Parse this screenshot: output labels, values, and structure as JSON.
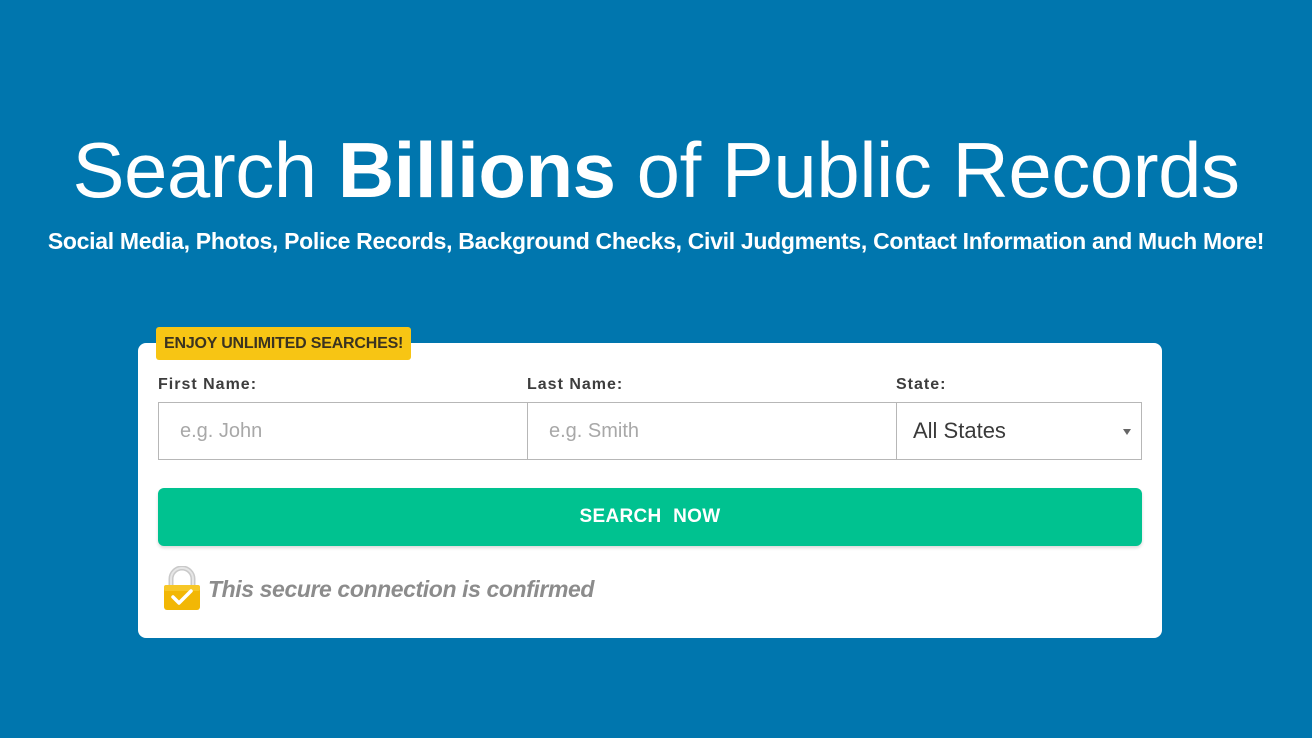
{
  "hero": {
    "title_part1": "Search ",
    "title_bold": "Billions",
    "title_part2": " of Public Records",
    "subtitle": "Social Media, Photos, Police Records, Background Checks, Civil Judgments, Contact Information and Much More!"
  },
  "form": {
    "promo_badge": "ENJOY UNLIMITED SEARCHES!",
    "first_name_label": "First Name:",
    "first_name_placeholder": "e.g. John",
    "last_name_label": "Last Name:",
    "last_name_placeholder": "e.g. Smith",
    "state_label": "State:",
    "state_selected": "All States",
    "search_button_label": "SEARCH NOW",
    "secure_message": "This secure connection is confirmed"
  },
  "icons": {
    "lock": "padlock-check-icon",
    "dropdown": "chevron-down-icon"
  },
  "colors": {
    "background": "#0076ae",
    "button": "#00c290",
    "badge": "#f7c514",
    "lock": "#f2b705"
  }
}
